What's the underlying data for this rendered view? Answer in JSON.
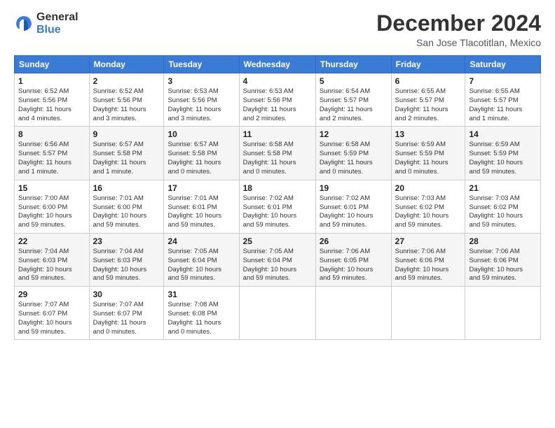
{
  "logo": {
    "general": "General",
    "blue": "Blue"
  },
  "header": {
    "month": "December 2024",
    "location": "San Jose Tlacotitlan, Mexico"
  },
  "days_of_week": [
    "Sunday",
    "Monday",
    "Tuesday",
    "Wednesday",
    "Thursday",
    "Friday",
    "Saturday"
  ],
  "weeks": [
    [
      {
        "day": "1",
        "info": "Sunrise: 6:52 AM\nSunset: 5:56 PM\nDaylight: 11 hours\nand 4 minutes."
      },
      {
        "day": "2",
        "info": "Sunrise: 6:52 AM\nSunset: 5:56 PM\nDaylight: 11 hours\nand 3 minutes."
      },
      {
        "day": "3",
        "info": "Sunrise: 6:53 AM\nSunset: 5:56 PM\nDaylight: 11 hours\nand 3 minutes."
      },
      {
        "day": "4",
        "info": "Sunrise: 6:53 AM\nSunset: 5:56 PM\nDaylight: 11 hours\nand 2 minutes."
      },
      {
        "day": "5",
        "info": "Sunrise: 6:54 AM\nSunset: 5:57 PM\nDaylight: 11 hours\nand 2 minutes."
      },
      {
        "day": "6",
        "info": "Sunrise: 6:55 AM\nSunset: 5:57 PM\nDaylight: 11 hours\nand 2 minutes."
      },
      {
        "day": "7",
        "info": "Sunrise: 6:55 AM\nSunset: 5:57 PM\nDaylight: 11 hours\nand 1 minute."
      }
    ],
    [
      {
        "day": "8",
        "info": "Sunrise: 6:56 AM\nSunset: 5:57 PM\nDaylight: 11 hours\nand 1 minute."
      },
      {
        "day": "9",
        "info": "Sunrise: 6:57 AM\nSunset: 5:58 PM\nDaylight: 11 hours\nand 1 minute."
      },
      {
        "day": "10",
        "info": "Sunrise: 6:57 AM\nSunset: 5:58 PM\nDaylight: 11 hours\nand 0 minutes."
      },
      {
        "day": "11",
        "info": "Sunrise: 6:58 AM\nSunset: 5:58 PM\nDaylight: 11 hours\nand 0 minutes."
      },
      {
        "day": "12",
        "info": "Sunrise: 6:58 AM\nSunset: 5:59 PM\nDaylight: 11 hours\nand 0 minutes."
      },
      {
        "day": "13",
        "info": "Sunrise: 6:59 AM\nSunset: 5:59 PM\nDaylight: 11 hours\nand 0 minutes."
      },
      {
        "day": "14",
        "info": "Sunrise: 6:59 AM\nSunset: 5:59 PM\nDaylight: 10 hours\nand 59 minutes."
      }
    ],
    [
      {
        "day": "15",
        "info": "Sunrise: 7:00 AM\nSunset: 6:00 PM\nDaylight: 10 hours\nand 59 minutes."
      },
      {
        "day": "16",
        "info": "Sunrise: 7:01 AM\nSunset: 6:00 PM\nDaylight: 10 hours\nand 59 minutes."
      },
      {
        "day": "17",
        "info": "Sunrise: 7:01 AM\nSunset: 6:01 PM\nDaylight: 10 hours\nand 59 minutes."
      },
      {
        "day": "18",
        "info": "Sunrise: 7:02 AM\nSunset: 6:01 PM\nDaylight: 10 hours\nand 59 minutes."
      },
      {
        "day": "19",
        "info": "Sunrise: 7:02 AM\nSunset: 6:01 PM\nDaylight: 10 hours\nand 59 minutes."
      },
      {
        "day": "20",
        "info": "Sunrise: 7:03 AM\nSunset: 6:02 PM\nDaylight: 10 hours\nand 59 minutes."
      },
      {
        "day": "21",
        "info": "Sunrise: 7:03 AM\nSunset: 6:02 PM\nDaylight: 10 hours\nand 59 minutes."
      }
    ],
    [
      {
        "day": "22",
        "info": "Sunrise: 7:04 AM\nSunset: 6:03 PM\nDaylight: 10 hours\nand 59 minutes."
      },
      {
        "day": "23",
        "info": "Sunrise: 7:04 AM\nSunset: 6:03 PM\nDaylight: 10 hours\nand 59 minutes."
      },
      {
        "day": "24",
        "info": "Sunrise: 7:05 AM\nSunset: 6:04 PM\nDaylight: 10 hours\nand 59 minutes."
      },
      {
        "day": "25",
        "info": "Sunrise: 7:05 AM\nSunset: 6:04 PM\nDaylight: 10 hours\nand 59 minutes."
      },
      {
        "day": "26",
        "info": "Sunrise: 7:06 AM\nSunset: 6:05 PM\nDaylight: 10 hours\nand 59 minutes."
      },
      {
        "day": "27",
        "info": "Sunrise: 7:06 AM\nSunset: 6:06 PM\nDaylight: 10 hours\nand 59 minutes."
      },
      {
        "day": "28",
        "info": "Sunrise: 7:06 AM\nSunset: 6:06 PM\nDaylight: 10 hours\nand 59 minutes."
      }
    ],
    [
      {
        "day": "29",
        "info": "Sunrise: 7:07 AM\nSunset: 6:07 PM\nDaylight: 10 hours\nand 59 minutes."
      },
      {
        "day": "30",
        "info": "Sunrise: 7:07 AM\nSunset: 6:07 PM\nDaylight: 11 hours\nand 0 minutes."
      },
      {
        "day": "31",
        "info": "Sunrise: 7:08 AM\nSunset: 6:08 PM\nDaylight: 11 hours\nand 0 minutes."
      },
      {
        "day": "",
        "info": ""
      },
      {
        "day": "",
        "info": ""
      },
      {
        "day": "",
        "info": ""
      },
      {
        "day": "",
        "info": ""
      }
    ]
  ]
}
